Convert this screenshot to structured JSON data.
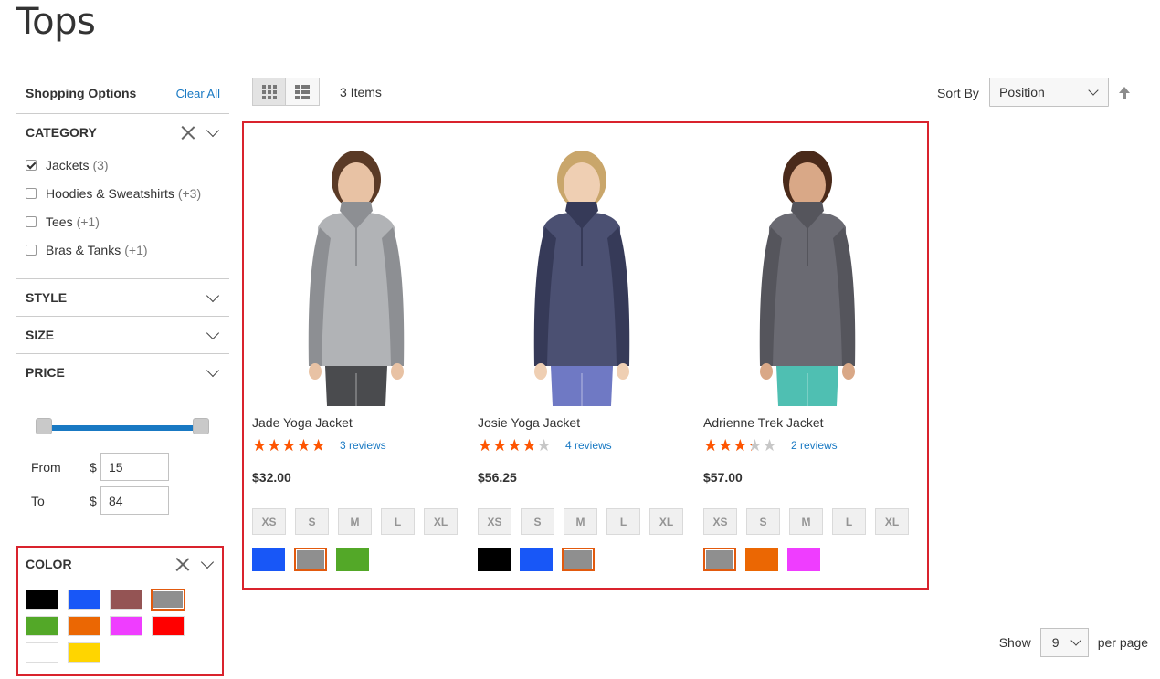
{
  "page": {
    "title": "Tops"
  },
  "sidebar": {
    "shopping_options": "Shopping Options",
    "clear_all": "Clear All",
    "category": {
      "title": "CATEGORY",
      "items": [
        {
          "label": "Jackets",
          "count": "(3)",
          "checked": true
        },
        {
          "label": "Hoodies & Sweatshirts",
          "count": "(+3)",
          "checked": false
        },
        {
          "label": "Tees",
          "count": "(+1)",
          "checked": false
        },
        {
          "label": "Bras & Tanks",
          "count": "(+1)",
          "checked": false
        }
      ]
    },
    "style": {
      "title": "STYLE"
    },
    "size": {
      "title": "SIZE"
    },
    "price": {
      "title": "PRICE",
      "from_label": "From",
      "to_label": "To",
      "currency": "$",
      "from_value": "15",
      "to_value": "84"
    },
    "color": {
      "title": "COLOR",
      "swatches": [
        {
          "name": "black",
          "hex": "#000000",
          "selected": false
        },
        {
          "name": "blue",
          "hex": "#1857f7",
          "selected": false
        },
        {
          "name": "brown",
          "hex": "#945454",
          "selected": false
        },
        {
          "name": "gray",
          "hex": "#8f8f8f",
          "selected": true
        },
        {
          "name": "green",
          "hex": "#53a828",
          "selected": false
        },
        {
          "name": "orange",
          "hex": "#eb6703",
          "selected": false
        },
        {
          "name": "purple",
          "hex": "#ef3dff",
          "selected": false
        },
        {
          "name": "red",
          "hex": "#ff0000",
          "selected": false
        },
        {
          "name": "white",
          "hex": "#ffffff",
          "selected": false
        },
        {
          "name": "yellow",
          "hex": "#ffd500",
          "selected": false
        }
      ]
    }
  },
  "toolbar": {
    "items_count": "3 Items",
    "sort_label": "Sort By",
    "sort_value": "Position",
    "show_label": "Show",
    "per_page_value": "9",
    "per_page_label": "per page"
  },
  "products": [
    {
      "name": "Jade Yoga Jacket",
      "rating": 4.5,
      "reviews": "3 reviews",
      "price": "$32.00",
      "sizes": [
        "XS",
        "S",
        "M",
        "L",
        "XL"
      ],
      "colors": [
        {
          "name": "blue",
          "hex": "#1857f7",
          "selected": false
        },
        {
          "name": "gray",
          "hex": "#8f8f8f",
          "selected": true
        },
        {
          "name": "green",
          "hex": "#53a828",
          "selected": false
        }
      ]
    },
    {
      "name": "Josie Yoga Jacket",
      "rating": 3.5,
      "reviews": "4 reviews",
      "price": "$56.25",
      "sizes": [
        "XS",
        "S",
        "M",
        "L",
        "XL"
      ],
      "colors": [
        {
          "name": "black",
          "hex": "#000000",
          "selected": false
        },
        {
          "name": "blue",
          "hex": "#1857f7",
          "selected": false
        },
        {
          "name": "gray",
          "hex": "#8f8f8f",
          "selected": true
        }
      ]
    },
    {
      "name": "Adrienne Trek Jacket",
      "rating": 3,
      "reviews": "2 reviews",
      "price": "$57.00",
      "sizes": [
        "XS",
        "S",
        "M",
        "L",
        "XL"
      ],
      "colors": [
        {
          "name": "gray",
          "hex": "#8f8f8f",
          "selected": true
        },
        {
          "name": "orange",
          "hex": "#eb6703",
          "selected": false
        },
        {
          "name": "purple",
          "hex": "#ef3dff",
          "selected": false
        }
      ]
    }
  ],
  "colors": {
    "accent_blue": "#1979c3",
    "star_fill": "#ff5501",
    "highlight_red": "#d9232d",
    "swatch_selected": "#e25a0e"
  }
}
